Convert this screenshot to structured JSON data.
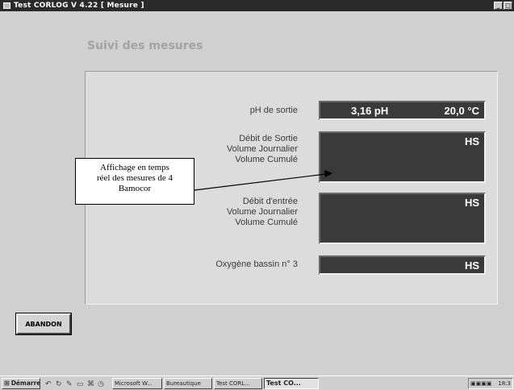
{
  "window": {
    "title": "Test  CORLOG  V 4.22  [ Mesure ]",
    "buttons": [
      "_",
      "□"
    ]
  },
  "section_title": "Suivi des mesures",
  "measures": {
    "ph_label": "pH de sortie",
    "ph_value": "3,16 pH",
    "temp_value": "20,0  °C",
    "out_lines": [
      "Débit de Sortie",
      "Volume Journalier",
      "Volume Cumulé"
    ],
    "out_value": "HS",
    "in_lines": [
      "Débit d'entrée",
      "Volume Journalier",
      "Volume Cumulé"
    ],
    "in_value": "HS",
    "oxygen_label": "Oxygène bassin n° 3",
    "oxygen_value": "HS"
  },
  "callout": {
    "lines": [
      "Affichage en temps",
      "réel des mesures de 4",
      "Bamocor"
    ]
  },
  "abandon_label": "ABANDON",
  "taskbar": {
    "start_label": "Démarrer",
    "quick_icons": [
      "undo-icon",
      "refresh-icon",
      "paint-icon",
      "folder-icon",
      "network-icon",
      "clock-icon"
    ],
    "items": [
      "Microsoft W...",
      "Bureautique",
      "Test  CORL...",
      "Test   CO..."
    ],
    "time": "18:3"
  }
}
